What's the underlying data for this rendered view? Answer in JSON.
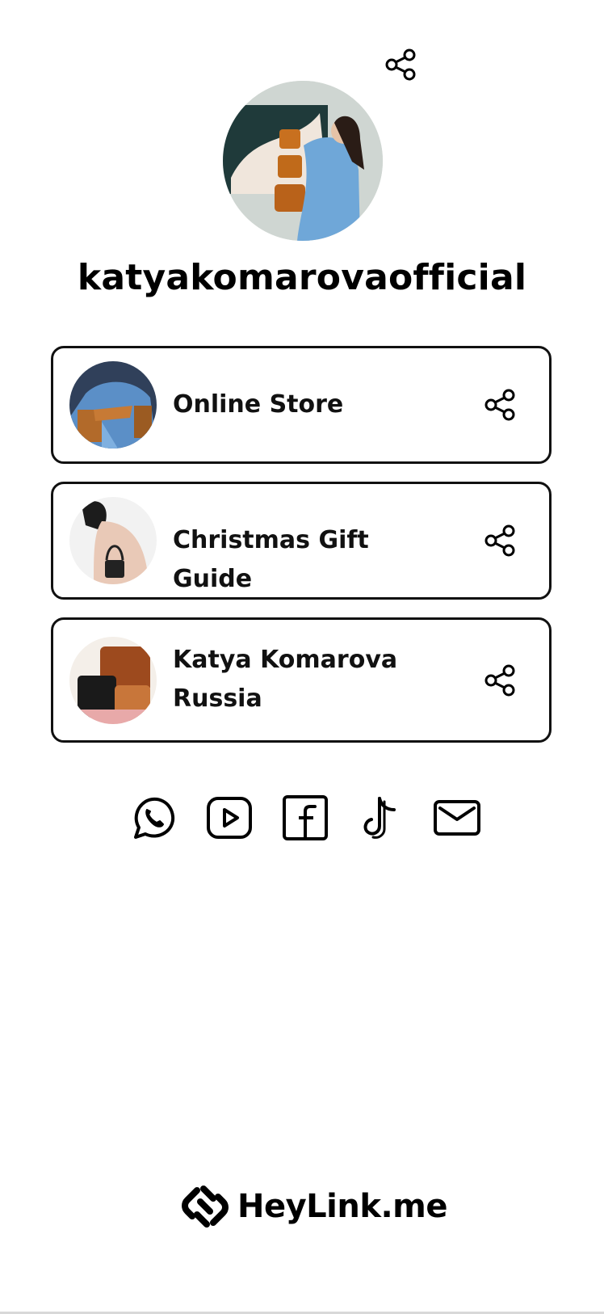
{
  "profile": {
    "username": "katyakomarovaofficial",
    "avatar_icon": "profile-photo"
  },
  "links": [
    {
      "label": "Online Store"
    },
    {
      "label": "Christmas Gift Guide"
    },
    {
      "label": "Katya Komarova\nRussia"
    }
  ],
  "socials": [
    "whatsapp-icon",
    "youtube-icon",
    "facebook-icon",
    "tiktok-icon",
    "mail-icon"
  ],
  "brand": {
    "name": "HeyLink.me"
  },
  "colors": {
    "text": "#000000",
    "border": "#111111",
    "background": "#ffffff"
  }
}
